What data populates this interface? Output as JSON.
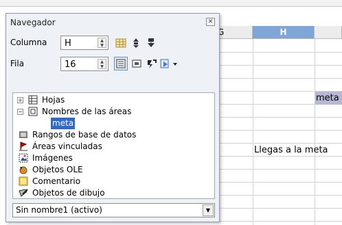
{
  "sheet": {
    "columns": [
      "G",
      "H"
    ],
    "selected_column": "H",
    "cell_meta": "meta",
    "cell_llegas": "Llegas a la meta"
  },
  "navigator": {
    "title": "Navegador",
    "column_label": "Columna",
    "column_value": "H",
    "row_label": "Fila",
    "row_value": "16",
    "tree": {
      "items": [
        {
          "label": "Hojas",
          "icon": "sheets-icon",
          "expander": "+"
        },
        {
          "label": "Nombres de las áreas",
          "icon": "range-names-icon",
          "expander": "−"
        },
        {
          "label": "meta",
          "child": true
        },
        {
          "label": "Rangos de base de datos",
          "icon": "database-range-icon"
        },
        {
          "label": "Áreas vinculadas",
          "icon": "linked-areas-icon"
        },
        {
          "label": "Imágenes",
          "icon": "images-icon"
        },
        {
          "label": "Objetos OLE",
          "icon": "ole-objects-icon"
        },
        {
          "label": "Comentario",
          "icon": "comment-icon"
        },
        {
          "label": "Objetos de dibujo",
          "icon": "drawing-objects-icon"
        }
      ]
    },
    "document_select": "Sin nombre1 (activo)"
  }
}
